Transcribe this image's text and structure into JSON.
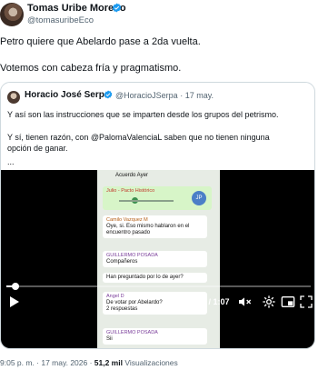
{
  "author": {
    "name": "Tomas Uribe Moreno",
    "handle": "@tomasuribeEco"
  },
  "tweet": {
    "line1": "Petro quiere que Abelardo pase a 2da vuelta.",
    "line2": "Votemos con cabeza fría y pragmatismo."
  },
  "quote": {
    "name": "Horacio José Serpa",
    "handle": "@HoracioJSerpa",
    "date": "17 may.",
    "line1": "Y así son las instrucciones que se imparten desde los grupos del petrismo.",
    "line2": "Y sí, tienen razón, con @PalomaValenciaL saben que no tienen ninguna",
    "line3": "opción de ganar.",
    "line4": "..."
  },
  "video": {
    "time": "0:02 / 1:07",
    "progress": 0.03,
    "chat": {
      "header": "Acuerdo Ayer",
      "voice_sender": "Julio - Pacto Histórico",
      "voice_badge": "JP",
      "msg1_sender": "Camilo Vazquez M",
      "msg1_text": "Oye, si. Eso mismo hablaron en el encuentro pasado",
      "msg2_sender": "GUILLERMO POSADA",
      "msg2_text": "Compañeros",
      "msg3_text": "Han preguntado por lo de ayer?",
      "msg4_sender": "Angel D",
      "msg4_text": "De votar por Abelardo?",
      "msg4_replies": "2 respuestas",
      "msg5_sender": "GUILLERMO POSADA",
      "msg5_text": "Sii"
    }
  },
  "footer": {
    "datetime": "9:05 p. m. · 17 may. 2026 · ",
    "views_count": "51,2 mil",
    "views_label": " Visualizaciones"
  }
}
